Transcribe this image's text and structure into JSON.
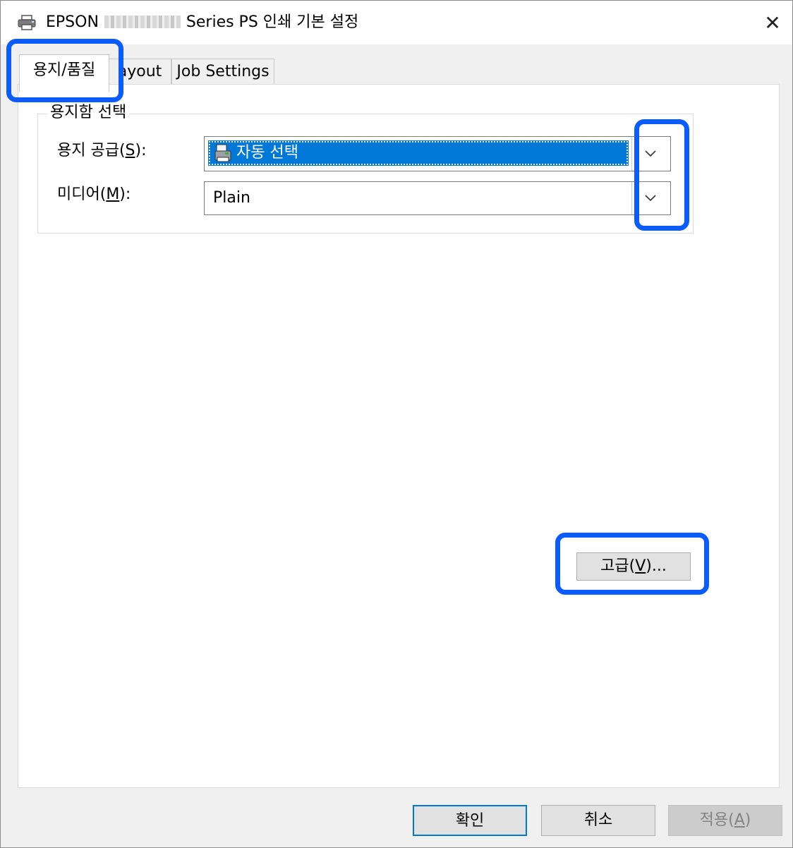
{
  "window": {
    "title_prefix": "EPSON",
    "title_suffix": "Series PS 인쇄 기본 설정",
    "close_glyph": "✕"
  },
  "tabs": [
    {
      "label": "용지/품질",
      "active": true
    },
    {
      "label": "ayout",
      "active": false
    },
    {
      "label": "Job Settings",
      "active": false
    }
  ],
  "tray_group": {
    "label": "용지함 선택",
    "paper_source": {
      "label_pre": "용지 공급(",
      "accel": "S",
      "label_post": "):",
      "value": "자동 선택"
    },
    "media": {
      "label_pre": "미디어(",
      "accel": "M",
      "label_post": "):",
      "value": "Plain"
    }
  },
  "advanced_button": {
    "pre": "고급(",
    "accel": "V",
    "post": ")..."
  },
  "footer": {
    "ok": "확인",
    "cancel": "취소",
    "apply_pre": "적용(",
    "apply_accel": "A",
    "apply_post": ")"
  },
  "highlight_color": "#0a5cff",
  "selection_color": "#0078d7",
  "icons": [
    "printer-icon",
    "close-icon",
    "chevron-down-icon",
    "paper-tray-icon"
  ]
}
